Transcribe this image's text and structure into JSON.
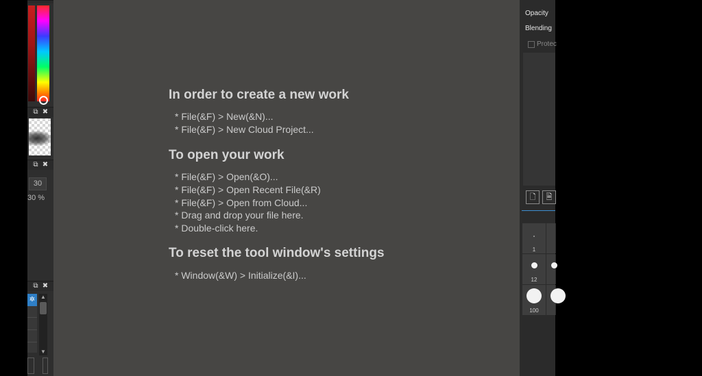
{
  "left_panel": {
    "size_value": "30",
    "percent_value": "30 %"
  },
  "canvas": {
    "sections": [
      {
        "heading": "In order to create a new work",
        "items": [
          "* File(&F) > New(&N)...",
          "* File(&F) > New Cloud Project..."
        ]
      },
      {
        "heading": "To open your work",
        "items": [
          "* File(&F) > Open(&O)...",
          "* File(&F) > Open Recent File(&R)",
          "* File(&F) > Open from Cloud...",
          "* Drag and drop your file here.",
          "* Double-click here."
        ]
      },
      {
        "heading": "To reset the tool window's settings",
        "items": [
          "* Window(&W) > Initialize(&I)..."
        ]
      }
    ]
  },
  "right_panel": {
    "opacity_label": "Opacity",
    "blending_label": "Blending",
    "protect_label": "Protec",
    "brush_sizes": [
      "1",
      "12",
      "100"
    ]
  },
  "icons": [
    "float-window-icon",
    "close-icon",
    "gear-icon",
    "new-layer-icon",
    "new-vector-layer-icon"
  ],
  "colors": {
    "canvas_bg": "#474644",
    "accent": "#3e8fd1",
    "gear_tile": "#2f7fc6"
  }
}
